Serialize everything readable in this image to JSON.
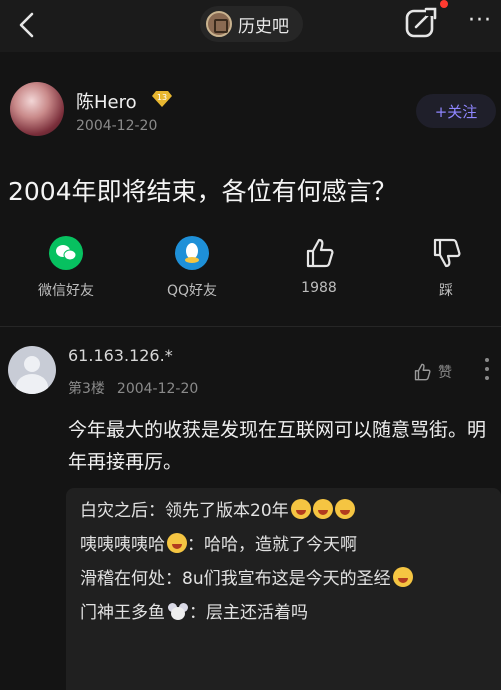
{
  "header": {
    "forum_name": "历史吧",
    "back_icon": "chevron-left-icon",
    "share_icon": "share-icon",
    "more_icon": "more-horizontal-icon",
    "notification_dot_color": "#ff3b30"
  },
  "post": {
    "author": "陈Hero",
    "level": "13",
    "date": "2004-12-20",
    "follow_label": "+关注",
    "title": "2004年即将结束，各位有何感言？"
  },
  "actions": [
    {
      "label": "微信好友",
      "icon": "wechat-icon",
      "color": "#07c160"
    },
    {
      "label": "QQ好友",
      "icon": "qq-icon",
      "color": "#1e90d8"
    },
    {
      "label": "1988",
      "icon": "thumbs-up-icon"
    },
    {
      "label": "踩",
      "icon": "thumbs-down-icon"
    }
  ],
  "comment": {
    "user": "61.163.126.*",
    "floor": "第3楼",
    "date": "2004-12-20",
    "like_label": "赞",
    "text": "今年最大的收获是发现在互联网可以随意骂街。明年再接再厉。",
    "replies": [
      {
        "user": "白灾之后",
        "sep": "：",
        "text": "领先了版本20年"
      },
      {
        "user": "咦咦咦咦哈",
        "sep": "：",
        "text": "哈哈，造就了今天啊"
      },
      {
        "user": "滑稽在何处",
        "sep": "：",
        "text": "8u们我宣布这是今天的圣经"
      },
      {
        "user": "门神王多鱼",
        "sep": "：",
        "text": "层主还活着吗"
      }
    ]
  }
}
